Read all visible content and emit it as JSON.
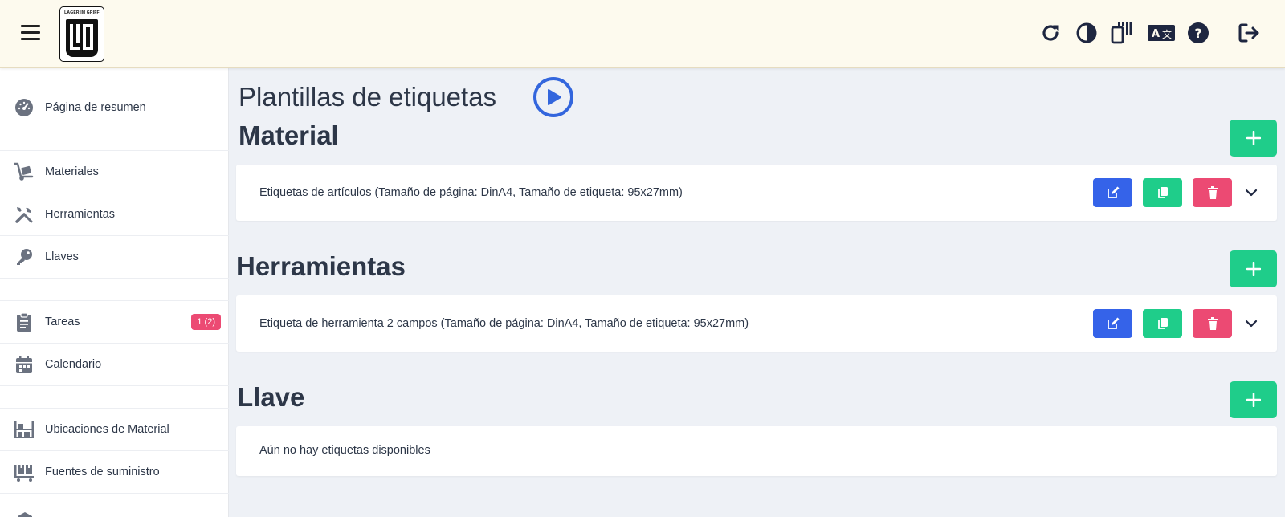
{
  "header": {
    "logo_text": "LAGER IM GRIFF",
    "icons": [
      "menu-icon",
      "refresh-icon",
      "contrast-icon",
      "pwa-icon",
      "translate-icon",
      "help-icon",
      "logout-icon"
    ]
  },
  "sidebar": {
    "items": [
      {
        "label": "Página de resumen",
        "icon": "dashboard-icon"
      },
      {
        "label": "Materiales",
        "icon": "dolly-icon"
      },
      {
        "label": "Herramientas",
        "icon": "tools-icon"
      },
      {
        "label": "Llaves",
        "icon": "key-icon"
      },
      {
        "label": "Tareas",
        "icon": "clipboard-icon",
        "badge": "1 (2)"
      },
      {
        "label": "Calendario",
        "icon": "calendar-icon"
      },
      {
        "label": "Ubicaciones de Material",
        "icon": "warehouse-icon"
      },
      {
        "label": "Fuentes de suministro",
        "icon": "supply-icon"
      }
    ]
  },
  "main": {
    "title": "Plantillas de etiquetas",
    "sections": [
      {
        "title": "Material",
        "row_text": "Etiquetas de artículos (Tamaño de página: DinA4, Tamaño de etiqueta: 95x27mm)"
      },
      {
        "title": "Herramientas",
        "row_text": "Etiqueta de herramienta 2 campos (Tamaño de página: DinA4, Tamaño de etiqueta: 95x27mm)"
      },
      {
        "title": "Llave",
        "empty_text": "Aún no hay etiquetas disponibles"
      }
    ]
  },
  "colors": {
    "header_bg": "#fdfaee",
    "page_bg": "#eef1f6",
    "green": "#1fcd8a",
    "blue": "#3563e9",
    "red": "#ec4a73",
    "play_blue": "#3366dd"
  }
}
